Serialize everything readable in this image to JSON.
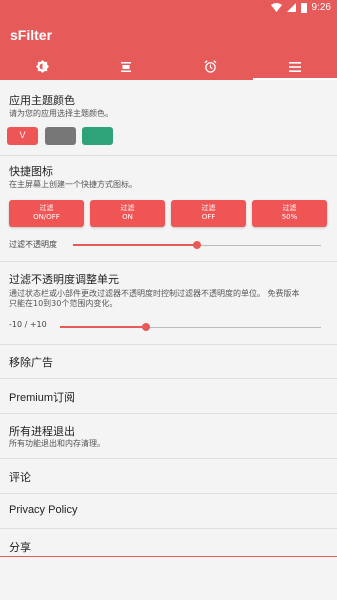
{
  "status_bar": {
    "time": "9:26"
  },
  "app": {
    "title": "sFilter"
  },
  "tabs": [
    {
      "name": "brightness"
    },
    {
      "name": "filter-toggle"
    },
    {
      "name": "alarm"
    },
    {
      "name": "menu"
    }
  ],
  "theme": {
    "title": "应用主题颜色",
    "subtitle": "请为您的应用选择主题颜色。",
    "swatches": [
      {
        "color": "#ee5555",
        "label": "V"
      },
      {
        "color": "#777777",
        "label": ""
      },
      {
        "color": "#2ea37a",
        "label": ""
      }
    ]
  },
  "shortcuts": {
    "title": "快捷图标",
    "subtitle": "在主屏幕上创建一个快捷方式图标。",
    "buttons": [
      {
        "line1": "过滤",
        "line2": "ON/OFF"
      },
      {
        "line1": "过滤",
        "line2": "ON"
      },
      {
        "line1": "过滤",
        "line2": "OFF"
      },
      {
        "line1": "过滤",
        "line2": "50%"
      }
    ],
    "opacity_label": "过滤不透明度",
    "opacity_value": 0.5
  },
  "adjust_unit": {
    "title": "过滤不透明度调整单元",
    "subtitle_line1": "通过状态栏或小部件更改过滤器不透明度时控制过滤器不透明度的单位。 免费版本",
    "subtitle_line2": "只能在10到30个范围内变化。",
    "range_label": "-10 / +10",
    "value": 0.33
  },
  "menu": {
    "remove_ads": "移除广告",
    "premium": "Premium订阅",
    "exit_title": "所有进程退出",
    "exit_subtitle": "所有功能退出和内存清理。",
    "review": "评论",
    "privacy": "Privacy Policy",
    "share": "分享"
  },
  "colors": {
    "accent": "#e75a5a"
  }
}
